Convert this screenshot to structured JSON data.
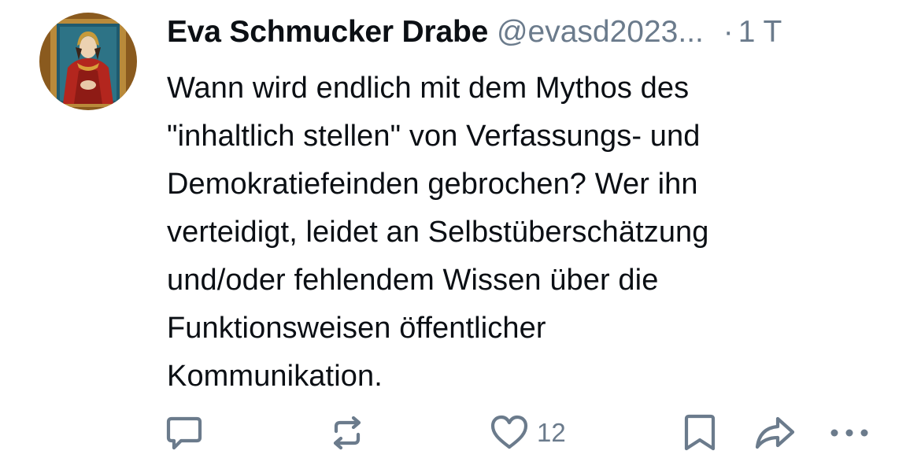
{
  "post": {
    "author": {
      "display_name": "Eva Schmucker Drabe",
      "handle": "@evasd2023...",
      "avatar_icon": "portrait-painting-avatar"
    },
    "separator": "·",
    "timestamp": "1 T",
    "text": "Wann wird endlich mit dem Mythos des\n\"inhaltlich stellen\" von Verfassungs- und\nDemokratiefeinden gebrochen? Wer ihn\nverteidigt, leidet an Selbstüberschätzung\nund/oder fehlendem Wissen über die\nFunktionsweisen öffentlicher\nKommunikation."
  },
  "actions": {
    "reply": {
      "icon": "reply-icon"
    },
    "repost": {
      "icon": "repost-icon"
    },
    "like": {
      "icon": "heart-icon",
      "count": "12"
    },
    "bookmark": {
      "icon": "bookmark-icon"
    },
    "share": {
      "icon": "share-icon"
    },
    "more": {
      "icon": "more-icon"
    }
  },
  "colors": {
    "text": "#0b0f14",
    "muted": "#6b7b8c",
    "background": "#ffffff"
  }
}
